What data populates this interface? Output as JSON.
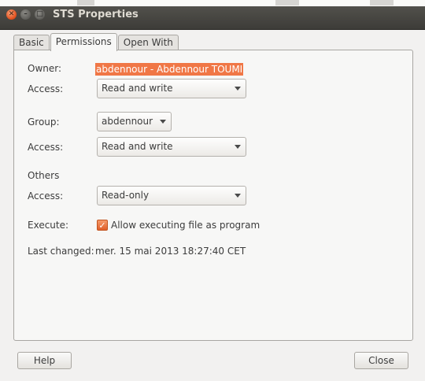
{
  "window": {
    "title": "STS Properties"
  },
  "tabs": [
    {
      "label": "Basic"
    },
    {
      "label": "Permissions"
    },
    {
      "label": "Open With"
    }
  ],
  "active_tab": "Permissions",
  "permissions": {
    "owner_label": "Owner:",
    "owner_value": "abdennour - Abdennour TOUMI",
    "owner_access_label": "Access:",
    "owner_access_value": "Read and write",
    "group_label": "Group:",
    "group_value": "abdennour",
    "group_access_label": "Access:",
    "group_access_value": "Read and write",
    "others_heading": "Others",
    "others_access_label": "Access:",
    "others_access_value": "Read-only",
    "execute_label": "Execute:",
    "execute_checkbox_label": "Allow executing file as program",
    "execute_checked": true,
    "last_changed_label": "Last changed:",
    "last_changed_value": "mer. 15 mai 2013 18:27:40 CET"
  },
  "buttons": {
    "help": "Help",
    "close": "Close"
  },
  "colors": {
    "accent": "#f07746",
    "titlebar": "#3d3c38"
  }
}
